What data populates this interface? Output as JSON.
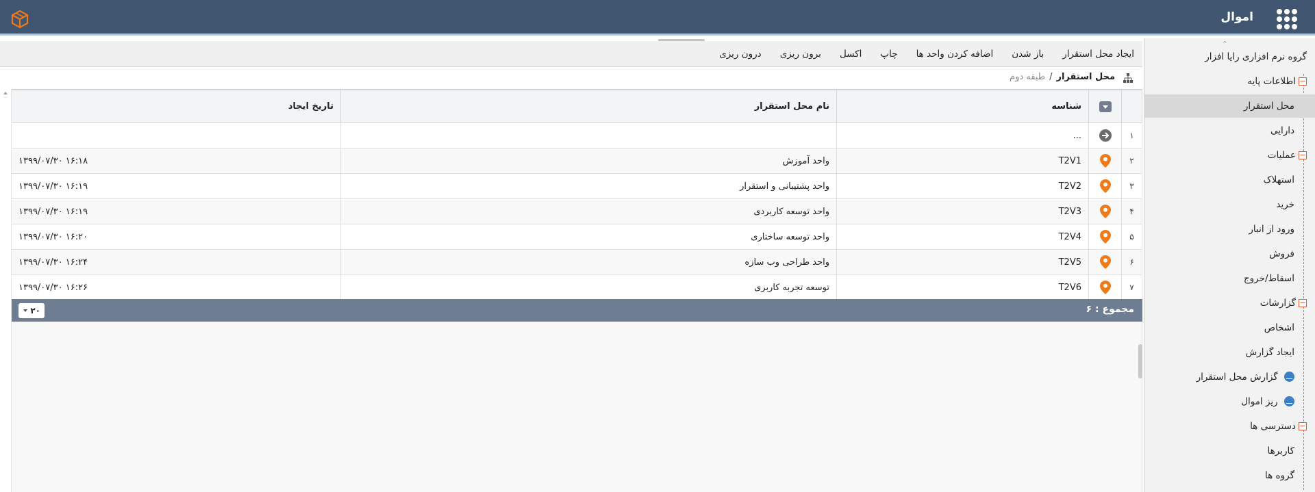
{
  "header": {
    "app_title": "اموال",
    "apps_icon": "apps-grid-icon",
    "logo_icon": "cube-logo-icon",
    "brand_color": "#3f5570",
    "accent_color": "#f07a1a"
  },
  "sidebar": {
    "org": "گروه نرم افزاری رایا افزار",
    "groups": [
      {
        "label": "اطلاعات پایه",
        "items": [
          "محل استقرار",
          "دارایی"
        ]
      },
      {
        "label": "عملیات",
        "items": [
          "استهلاک",
          "خرید",
          "ورود از انبار",
          "فروش",
          "اسقاط/خروج"
        ]
      },
      {
        "label": "گزارشات",
        "items": [
          "اشخاص",
          "ایجاد گزارش",
          "گزارش محل استقرار",
          "ریز اموال"
        ]
      },
      {
        "label": "دسترسی ها",
        "items": [
          "کاربرها",
          "گروه ها"
        ]
      }
    ],
    "active_item": "محل استقرار"
  },
  "toolbar": {
    "buttons": [
      "ایجاد محل استقرار",
      "باز شدن",
      "اضافه کردن واحد ها",
      "چاپ",
      "اکسل",
      "برون ریزی",
      "درون ریزی"
    ]
  },
  "breadcrumb": {
    "current": "محل استقرار",
    "separator": "/",
    "previous": "طبقه دوم"
  },
  "grid": {
    "columns": {
      "id": "شناسه",
      "name": "نام محل استقرار",
      "created": "تاریخ ایجاد"
    },
    "new_row": {
      "num": "۱",
      "placeholder": "..."
    },
    "rows": [
      {
        "num": "۲",
        "id": "T2V1",
        "name": "واحد آموزش",
        "created": "۱۳۹۹/۰۷/۳۰ ۱۶:۱۸"
      },
      {
        "num": "۳",
        "id": "T2V2",
        "name": "واحد پشتیبانی و استقرار",
        "created": "۱۳۹۹/۰۷/۳۰ ۱۶:۱۹"
      },
      {
        "num": "۴",
        "id": "T2V3",
        "name": "واحد توسعه کاربردی",
        "created": "۱۳۹۹/۰۷/۳۰ ۱۶:۱۹"
      },
      {
        "num": "۵",
        "id": "T2V4",
        "name": "واحد توسعه ساختاری",
        "created": "۱۳۹۹/۰۷/۳۰ ۱۶:۲۰"
      },
      {
        "num": "۶",
        "id": "T2V5",
        "name": "واحد طراحی وب سازه",
        "created": "۱۳۹۹/۰۷/۳۰ ۱۶:۲۴"
      },
      {
        "num": "۷",
        "id": "T2V6",
        "name": "توسعه تجربه کاربری",
        "created": "۱۳۹۹/۰۷/۳۰ ۱۶:۲۶"
      }
    ],
    "footer": {
      "total": "مجموع : ۶",
      "page_size": "۲۰"
    }
  }
}
